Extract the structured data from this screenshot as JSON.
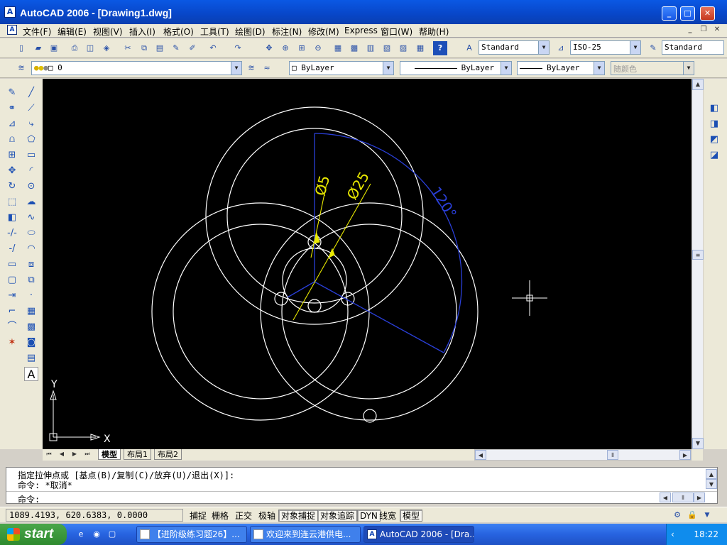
{
  "window": {
    "title": "AutoCAD 2006 - [Drawing1.dwg]",
    "app_icon": "autocad-app-icon",
    "minimize": "_",
    "maximize": "□",
    "close": "✕"
  },
  "menubar": {
    "items": [
      "文件(F)",
      "编辑(E)",
      "视图(V)",
      "插入(I)",
      "格式(O)",
      "工具(T)",
      "绘图(D)",
      "标注(N)",
      "修改(M)",
      "Express",
      "窗口(W)",
      "帮助(H)"
    ],
    "mdi_min": "_",
    "mdi_restore": "❐",
    "mdi_close": "✕"
  },
  "toolbar_standard": {
    "text_style": "Standard",
    "dim_style": "ISO-25",
    "table_style": "Standard"
  },
  "toolbar_layers": {
    "layer": "0",
    "color": "ByLayer",
    "linetype": "ByLayer",
    "lineweight": "ByLayer",
    "plotstyle": "随颜色"
  },
  "drawing": {
    "dim_labels": [
      "Ø5",
      "Ø25",
      "120°"
    ],
    "ucs_x": "X",
    "ucs_y": "Y"
  },
  "layout_tabs": [
    "模型",
    "布局1",
    "布局2"
  ],
  "command": {
    "history_1": "指定拉伸点或 [基点(B)/复制(C)/放弃(U)/退出(X)]:",
    "history_2": "命令: *取消*",
    "prompt": "命令:"
  },
  "status": {
    "coordinates": "1089.4193, 620.6383, 0.0000",
    "toggles": [
      {
        "label": "捕捉",
        "on": false
      },
      {
        "label": "栅格",
        "on": false
      },
      {
        "label": "正交",
        "on": false
      },
      {
        "label": "极轴",
        "on": false
      },
      {
        "label": "对象捕捉",
        "on": true
      },
      {
        "label": "对象追踪",
        "on": true
      },
      {
        "label": "DYN",
        "on": true
      },
      {
        "label": "线宽",
        "on": false
      },
      {
        "label": "模型",
        "on": true
      }
    ]
  },
  "taskbar": {
    "start": "start",
    "items": [
      "【进阶级练习题26】...",
      "欢迎来到连云港供电...",
      "AutoCAD 2006 - [Dra..."
    ],
    "clock": "18:22"
  }
}
